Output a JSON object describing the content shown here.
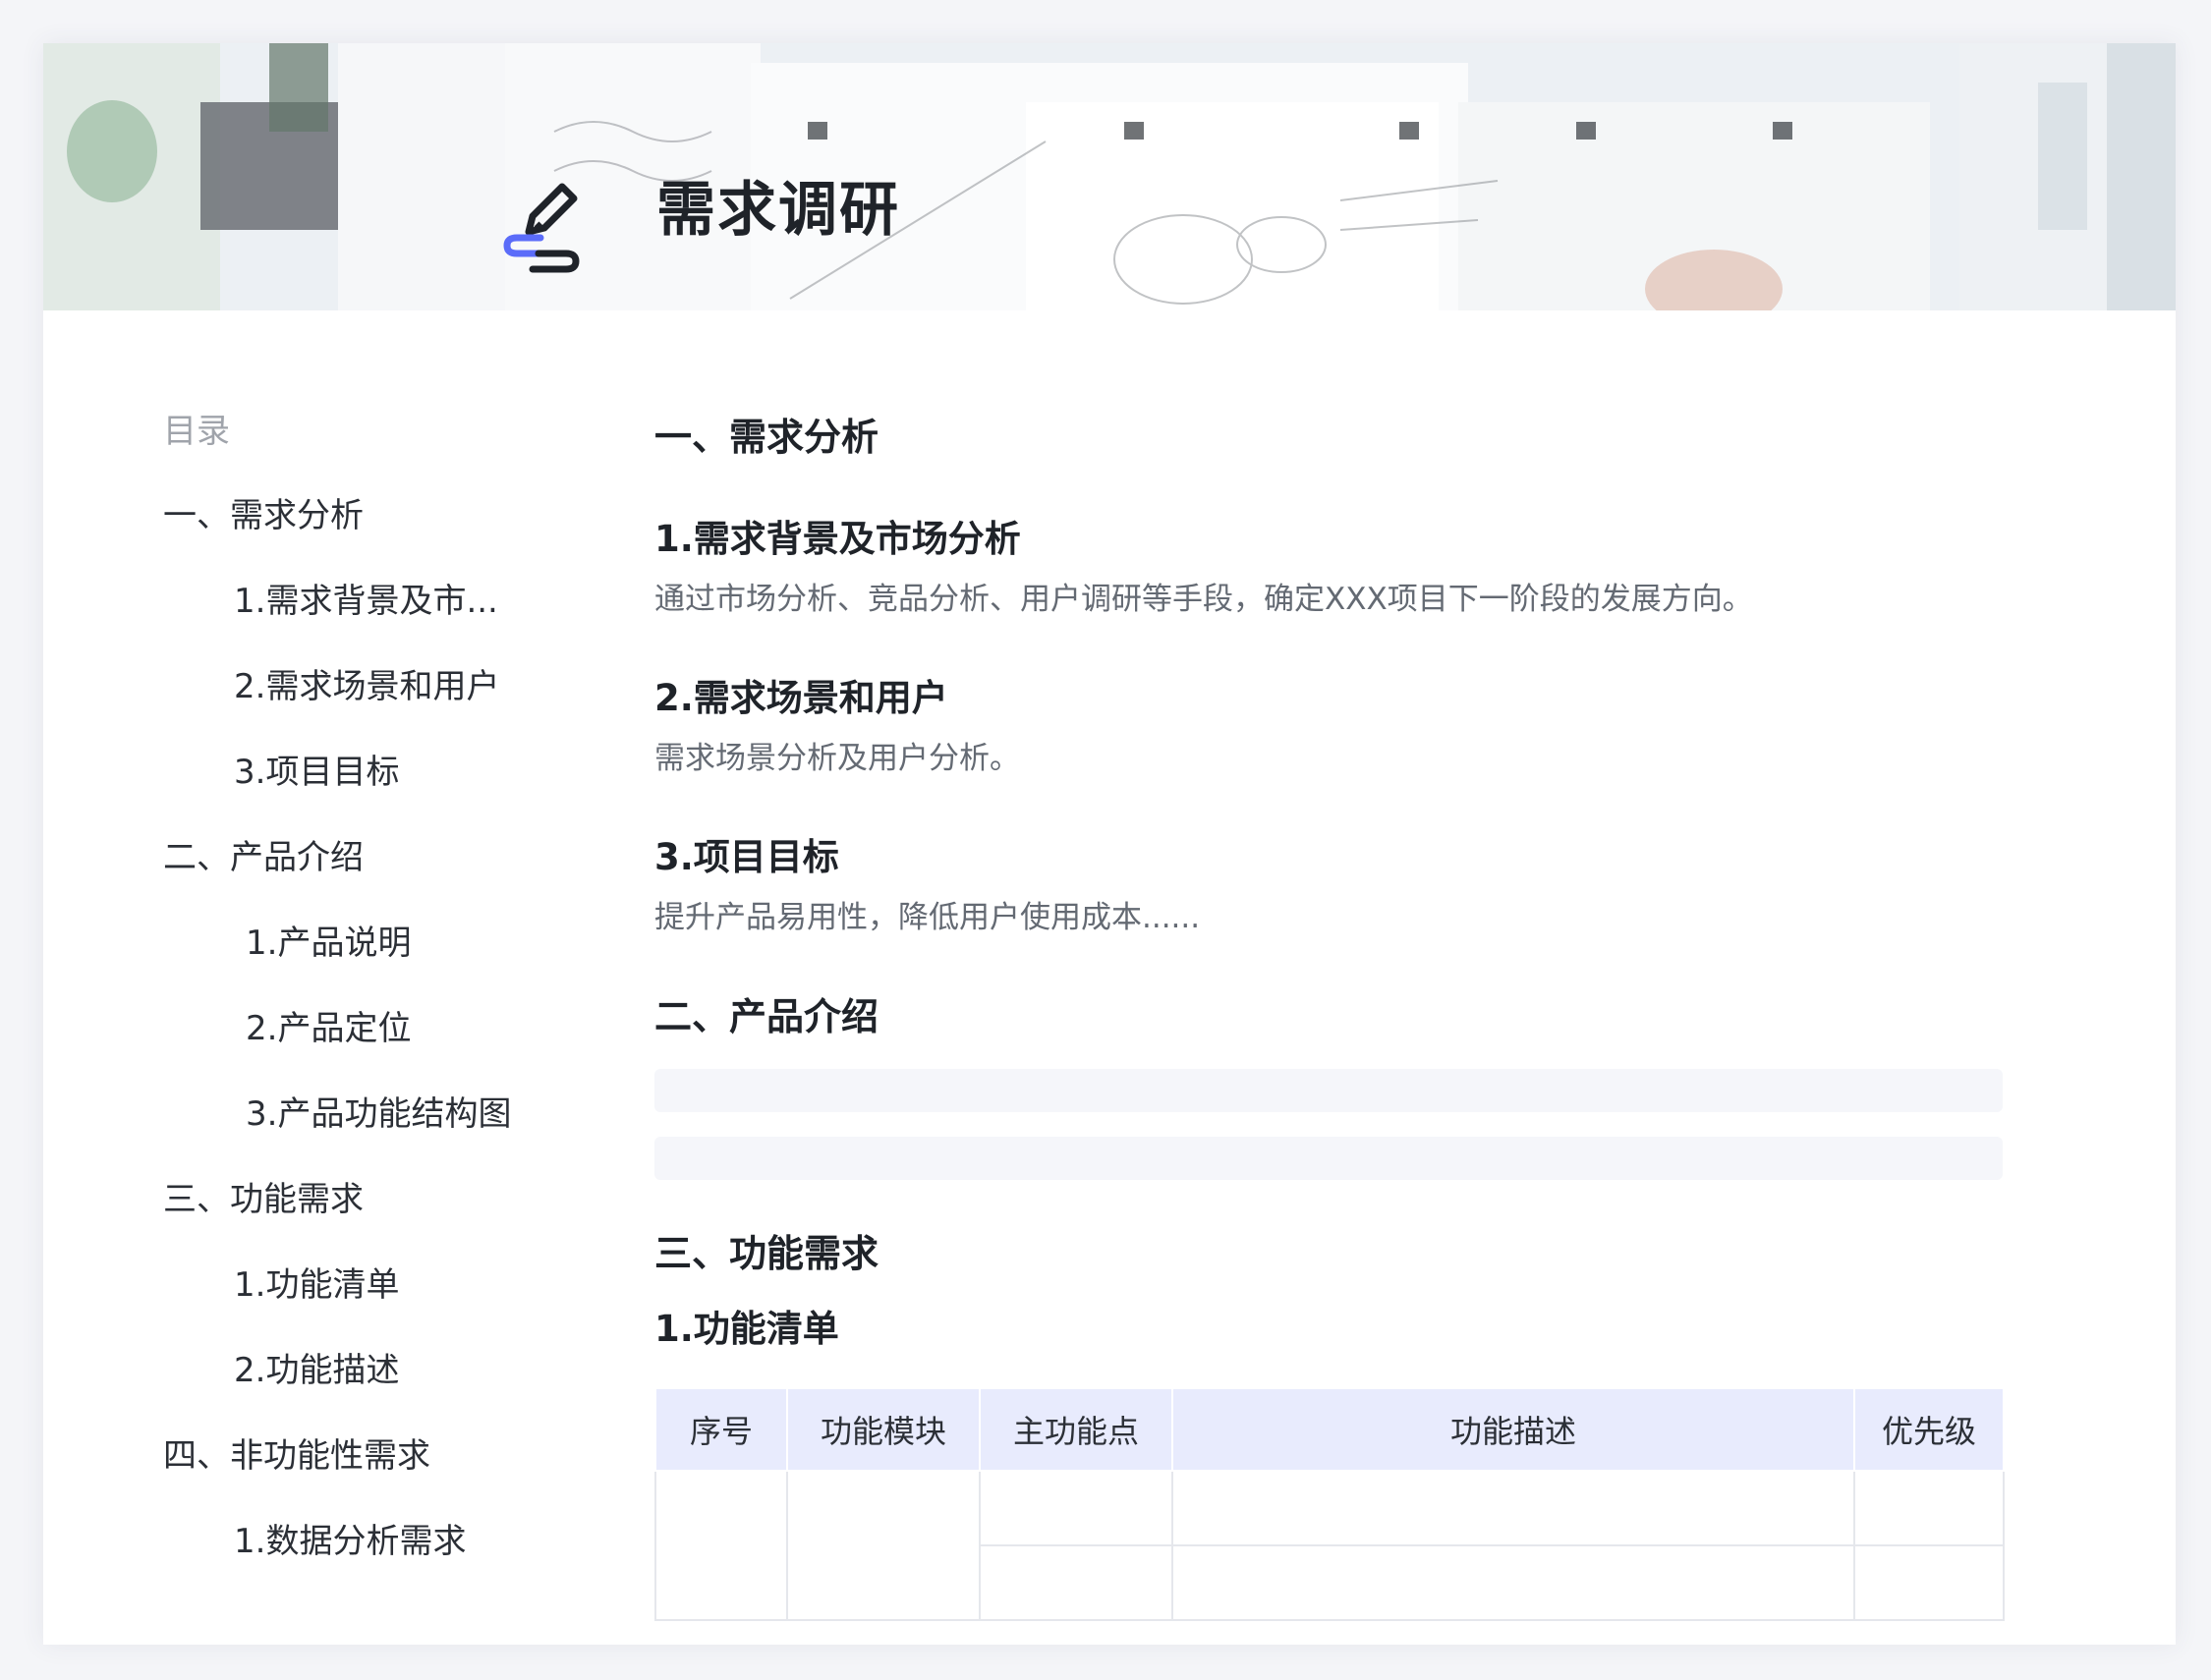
{
  "banner": {
    "title": "需求调研",
    "icon": "pen-sign-icon",
    "icon_colors": {
      "pen": "#1f2329",
      "line": "#5b6cf9"
    }
  },
  "toc": {
    "heading": "目录",
    "items": [
      "一、需求分析",
      "1.需求背景及市...",
      "2.需求场景和用户",
      "3.项目目标",
      "二、产品介绍",
      "1.产品说明",
      "2.产品定位",
      "3.产品功能结构图",
      "三、功能需求",
      "1.功能清单",
      "2.功能描述",
      "四、非功能性需求",
      "1.数据分析需求"
    ]
  },
  "content": {
    "section1": {
      "title": "一、需求分析",
      "sub1": {
        "title": "1.需求背景及市场分析",
        "text": "通过市场分析、竞品分析、用户调研等手段，确定XXX项目下一阶段的发展方向。"
      },
      "sub2": {
        "title": "2.需求场景和用户",
        "text": "需求场景分析及用户分析。"
      },
      "sub3": {
        "title": "3.项目目标",
        "text": "提升产品易用性，降低用户使用成本......"
      }
    },
    "section2": {
      "title": "二、产品介绍"
    },
    "section3": {
      "title": "三、功能需求",
      "sub1": {
        "title": "1.功能清单"
      }
    },
    "table": {
      "headers": [
        "序号",
        "功能模块",
        "主功能点",
        "功能描述",
        "优先级"
      ],
      "header_bg": "#e8ebfd"
    }
  }
}
